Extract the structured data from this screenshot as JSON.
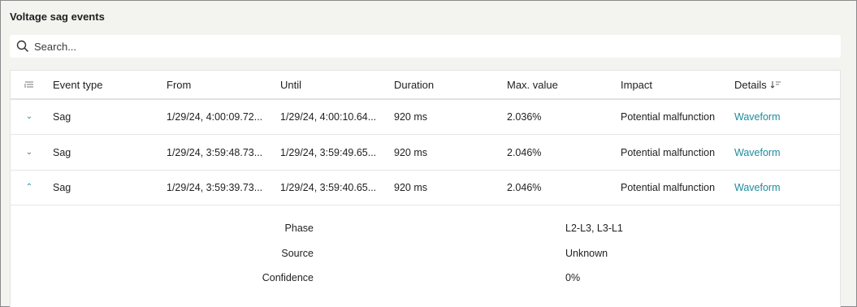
{
  "panel": {
    "title": "Voltage sag events"
  },
  "search": {
    "placeholder": "Search..."
  },
  "table": {
    "headers": {
      "event_type": "Event type",
      "from": "From",
      "until": "Until",
      "duration": "Duration",
      "max_value": "Max. value",
      "impact": "Impact",
      "details": "Details"
    },
    "rows": [
      {
        "expanded": false,
        "event_type": "Sag",
        "from": "1/29/24, 4:00:09.72...",
        "until": "1/29/24, 4:00:10.64...",
        "duration": "920 ms",
        "max_value": "2.036%",
        "impact": "Potential malfunction",
        "details": "Waveform"
      },
      {
        "expanded": false,
        "event_type": "Sag",
        "from": "1/29/24, 3:59:48.73...",
        "until": "1/29/24, 3:59:49.65...",
        "duration": "920 ms",
        "max_value": "2.046%",
        "impact": "Potential malfunction",
        "details": "Waveform"
      },
      {
        "expanded": true,
        "event_type": "Sag",
        "from": "1/29/24, 3:59:39.73...",
        "until": "1/29/24, 3:59:40.65...",
        "duration": "920 ms",
        "max_value": "2.046%",
        "impact": "Potential malfunction",
        "details": "Waveform"
      }
    ],
    "expanded_details": [
      {
        "label": "Phase",
        "value": "L2-L3, L3-L1"
      },
      {
        "label": "Source",
        "value": "Unknown"
      },
      {
        "label": "Confidence",
        "value": "0%"
      }
    ]
  },
  "icons": {
    "search": "search-icon",
    "column_settings": "column-settings-icon",
    "expand": "chevron-down-icon",
    "collapse": "chevron-up-icon",
    "sort": "sort-descending-icon"
  },
  "colors": {
    "link": "#1e8c9c",
    "background": "#f3f3f0"
  }
}
